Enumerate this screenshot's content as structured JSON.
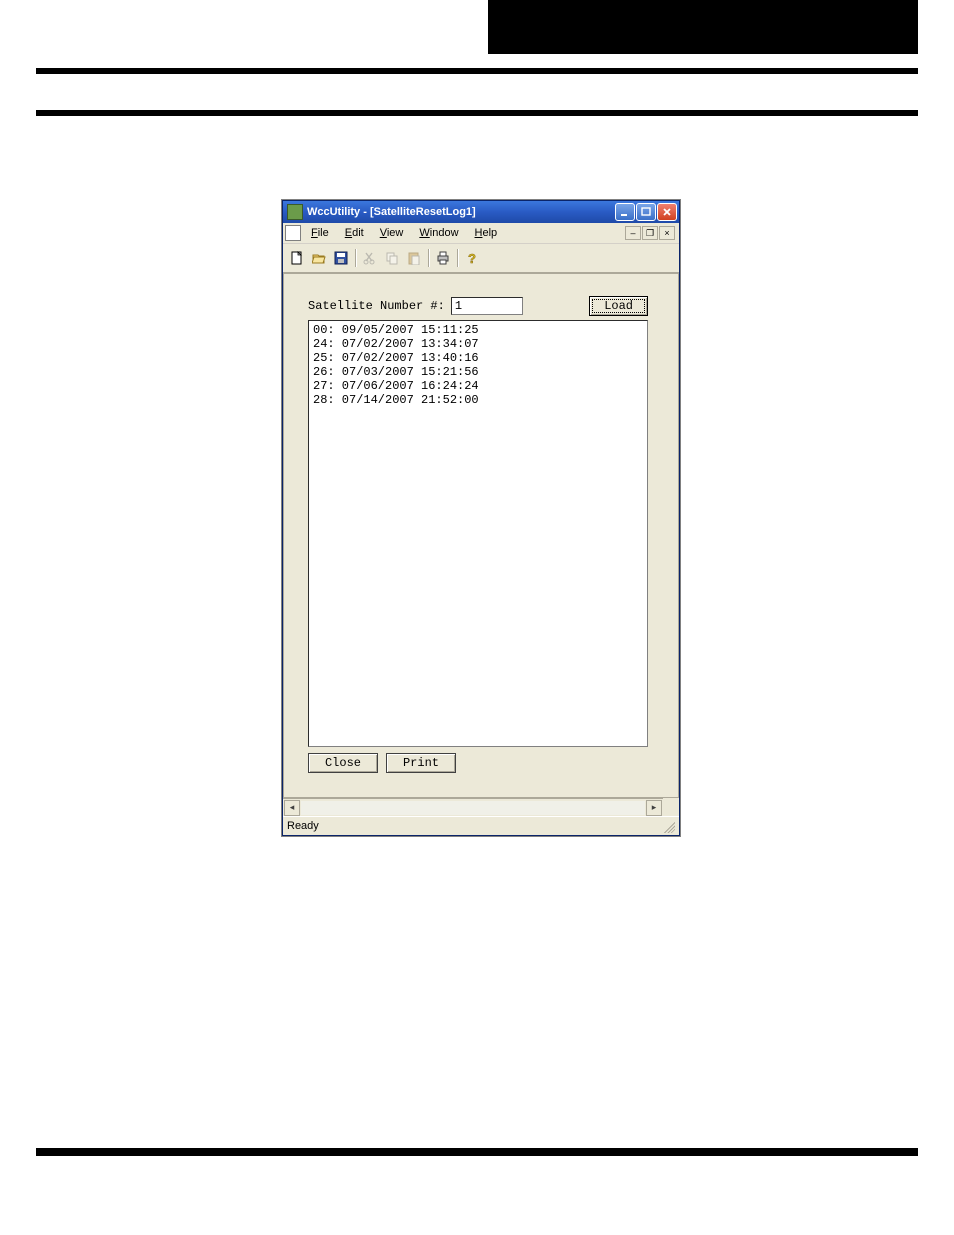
{
  "titlebar": {
    "title": "WccUtility - [SatelliteResetLog1]"
  },
  "menu": {
    "items": [
      "File",
      "Edit",
      "View",
      "Window",
      "Help"
    ]
  },
  "toolbar": {
    "icons": [
      "new",
      "open",
      "save",
      "cut",
      "copy",
      "paste",
      "print",
      "help"
    ]
  },
  "form": {
    "sat_label": "Satellite Number #:",
    "sat_value": "1",
    "load_label": "Load",
    "close_label": "Close",
    "print_label": "Print"
  },
  "log_lines": [
    "00: 09/05/2007 15:11:25",
    "24: 07/02/2007 13:34:07",
    "25: 07/02/2007 13:40:16",
    "26: 07/03/2007 15:21:56",
    "27: 07/06/2007 16:24:24",
    "28: 07/14/2007 21:52:00"
  ],
  "status": {
    "text": "Ready"
  }
}
